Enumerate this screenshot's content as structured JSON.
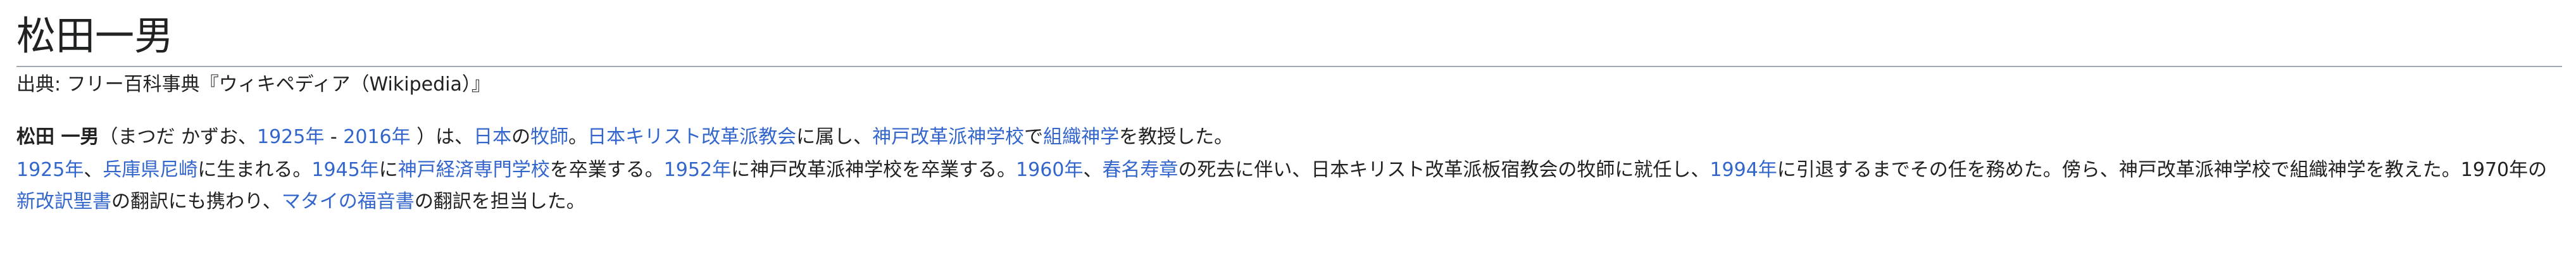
{
  "article": {
    "title": "松田一男",
    "from": "出典: フリー百科事典『ウィキペディア（Wikipedia）』"
  },
  "lead": {
    "name_bold": "松田 一男",
    "t1": "（まつだ かずお、",
    "l_1925": "1925年",
    "t2": " - ",
    "l_2016": "2016年",
    "t3": " ）は、",
    "l_japan": "日本",
    "t4": "の",
    "l_pastor": "牧師",
    "t5": "。",
    "l_church": "日本キリスト改革派教会",
    "t6": "に属し、",
    "l_seminary": "神戸改革派神学校",
    "t7": "で",
    "l_theology": "組織神学",
    "t8": "を教授した。"
  },
  "bio": {
    "l_1925": "1925年",
    "t1": "、",
    "l_amagasaki": "兵庫県尼崎",
    "t2": "に生まれる。",
    "l_1945": "1945年",
    "t3": "に",
    "l_kobekeizai": "神戸経済専門学校",
    "t4": "を卒業する。",
    "l_1952": "1952年",
    "t5": "に神戸改革派神学校を卒業する。",
    "l_1960": "1960年",
    "t6": "、",
    "l_kasuga": "春名寿章",
    "t7": "の死去に伴い、日本キリスト改革派板宿教会の牧師に就任し、",
    "l_1994": "1994年",
    "t8": "に引退するまでその任を務めた。傍ら、神戸改革派神学校で組織神学を教えた。1970年の",
    "l_shinkaiyaku": "新改訳聖書",
    "t9": "の翻訳にも携わり、",
    "l_matthew": "マタイの福音書",
    "t10": "の翻訳を担当した。"
  },
  "colors": {
    "link": "#3366cc",
    "text": "#202122",
    "rule": "#a2a9b1"
  }
}
